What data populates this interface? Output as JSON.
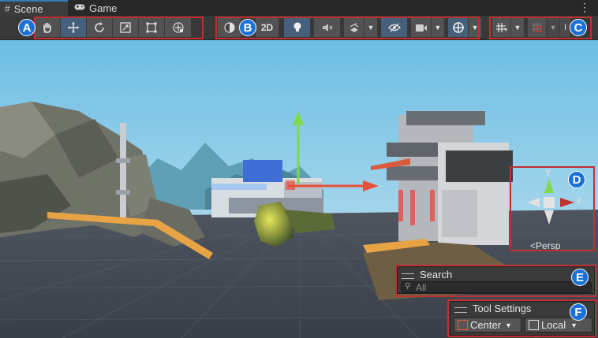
{
  "tabs": [
    {
      "label": "Scene",
      "icon": "grid-icon",
      "active": true
    },
    {
      "label": "Game",
      "icon": "gamepad-icon",
      "active": false
    }
  ],
  "menu_icon": "more-vertical-icon",
  "toolbar": {
    "transform_tools": [
      "hand-icon",
      "move-icon",
      "rotate-icon",
      "scale-icon",
      "rect-icon",
      "transform-icon"
    ],
    "view_options": {
      "draw_mode_icon": "shading-mode-icon",
      "mode_2d_label": "2D",
      "lighting_icon": "light-bulb-icon",
      "audio_icon": "audio-mute-icon",
      "effects_icon": "effects-icon",
      "hidden_objects_icon": "visibility-icon",
      "camera_icon": "camera-icon",
      "gizmos_icon": "gizmos-icon"
    },
    "snap_options": [
      "grid-snap-icon",
      "increment-snap-icon"
    ],
    "snap_truncated_label": "I"
  },
  "callouts": [
    "A",
    "B",
    "C",
    "D",
    "E",
    "F"
  ],
  "orientation_gizmo": {
    "y_label": "y",
    "x_label": "x",
    "projection_label": "Persp"
  },
  "search_overlay": {
    "title": "Search",
    "placeholder": "All"
  },
  "tool_settings": {
    "title": "Tool Settings",
    "pivot_label": "Center",
    "space_label": "Local"
  },
  "colors": {
    "callout": "#1a72d8",
    "highlight": "#c2302f",
    "active_tool": "#46607c",
    "tab_accent": "#3a79bb"
  }
}
